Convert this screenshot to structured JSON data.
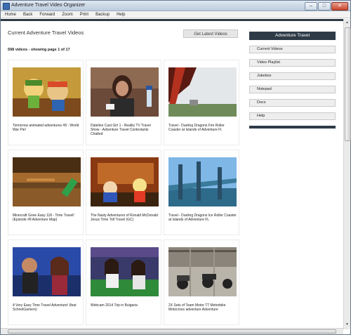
{
  "window": {
    "title": "Adventure Travel Video Organizer",
    "controls": {
      "minimize": "–",
      "maximize": "□",
      "close": "✕"
    }
  },
  "menu": [
    "Home",
    "Back",
    "Forward",
    "Zoom",
    "Print",
    "Backup",
    "Help"
  ],
  "main": {
    "title": "Current Adventure Travel Videos",
    "get_latest_label": "Get Latest Videos",
    "count_line": "598 videos - showing page 1 of 17",
    "videos": [
      {
        "caption": "Tomorrow animated adventures #8 - World War Pie!",
        "icon": "cartoon-thumbnail"
      },
      {
        "caption": "Dateline Cast Girl 1 - Reality TV Travel Show - Adventure Travel Contestants Chatted",
        "icon": "woman-thumbnail"
      },
      {
        "caption": "Travel - Dueling Dragons Fire Roller Coaster at Islands of Adventure Fl.",
        "icon": "coaster-thumbnail"
      },
      {
        "caption": "Minecraft Gone Easy 118 - Time Travel! (Episode #8 Adventure Map)",
        "icon": "minecraft-thumbnail"
      },
      {
        "caption": "The Nasty Adventures of Ronald McDonald Jesus Time Toll Travel (GC)",
        "icon": "clown-thumbnail"
      },
      {
        "caption": "Travel - Dueling Dragons Ice Roller Coaster at Islands of Adventure FL",
        "icon": "track-thumbnail"
      },
      {
        "caption": "4 Very Easy Time Travel Adventure! (feat SchoolGamers)",
        "icon": "people-thumbnail"
      },
      {
        "caption": "Webcam 2014 Trip in Bulgaria",
        "icon": "girls-thumbnail"
      },
      {
        "caption": "2X Sets of Team Motor TT Motorbike Motocross adventure Adventure",
        "icon": "motorbikes-thumbnail"
      }
    ]
  },
  "sidebar": {
    "title": "Adventure Travel",
    "items": [
      "Current Videos",
      "Video Playlist",
      "Jukebox",
      "Notepad",
      "Docs",
      "Help"
    ]
  },
  "scrollbar": {
    "up": "▲",
    "down": "▼"
  },
  "colors": {
    "accent": "#2e3b47",
    "titlebar": "#c6d3e2",
    "button": "#eeeeee"
  }
}
